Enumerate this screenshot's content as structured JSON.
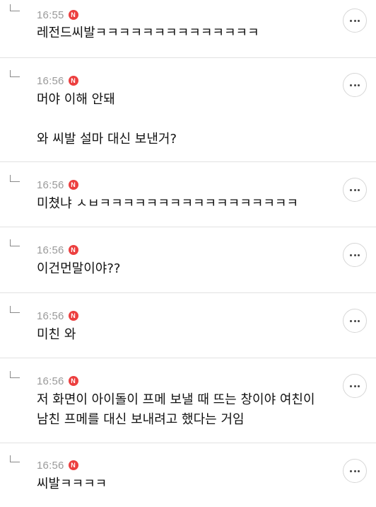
{
  "badge_label": "N",
  "badge_color": "#ec3f3f",
  "icons": {
    "reply_arrow": "reply-arrow-icon",
    "new_badge": "new-badge-icon",
    "more": "more-options-icon"
  },
  "replies": [
    {
      "time": "16:55",
      "text": "레전드씨발ㅋㅋㅋㅋㅋㅋㅋㅋㅋㅋㅋㅋㅋㅋ"
    },
    {
      "time": "16:56",
      "text": "머야 이해 안돼\n\n와 씨발 설마 대신 보낸거?"
    },
    {
      "time": "16:56",
      "text": "미쳤냐 ㅅㅂㅋㅋㅋㅋㅋㅋㅋㅋㅋㅋㅋㅋㅋㅋㅋㅋㅋ"
    },
    {
      "time": "16:56",
      "text": "이건먼말이야??"
    },
    {
      "time": "16:56",
      "text": "미친 와"
    },
    {
      "time": "16:56",
      "text": "저 화면이 아이돌이 프메 보낼 때 뜨는 창이야 여친이 남친 프메를 대신 보내려고 했다는 거임"
    },
    {
      "time": "16:56",
      "text": "씨발ㅋㅋㅋㅋ"
    }
  ]
}
